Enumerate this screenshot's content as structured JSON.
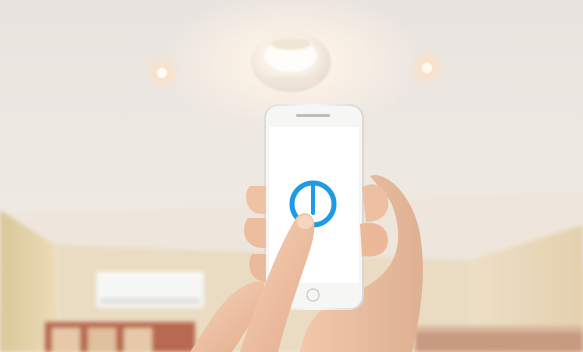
{
  "scene": {
    "photo_name": "smartphone-power-button-ceiling-lights",
    "colors": {
      "ceiling": "#ece6e1",
      "wall_left": "#e5d7b1",
      "wall_right": "#eadbbf",
      "phone_body": "#f3f2f0",
      "phone_screen": "#ffffff",
      "power_icon": "#1e9be6",
      "skin": "#f2c6a8"
    },
    "icons": {
      "power": "power-icon"
    }
  }
}
